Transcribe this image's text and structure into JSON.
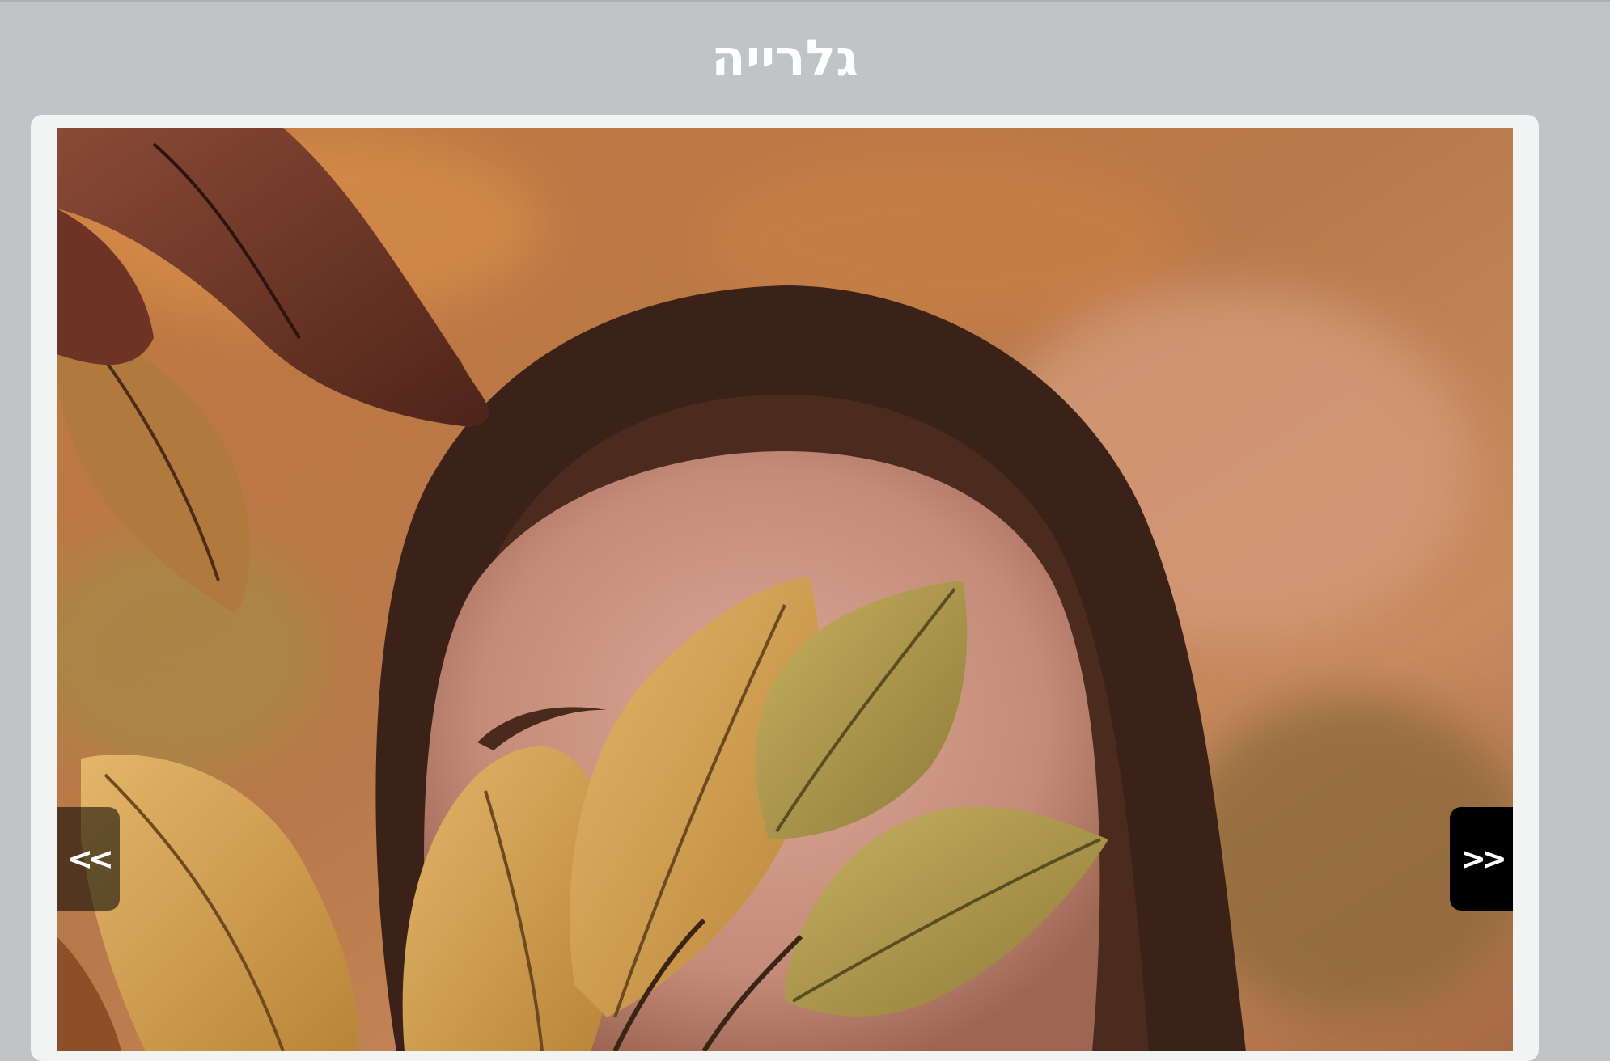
{
  "header": {
    "title": "גלרייה"
  },
  "gallery": {
    "prev_label": "<<",
    "next_label": ">>",
    "image_subject": "woman-holding-autumn-leaves-photo"
  },
  "colors": {
    "page_background": "#c0c4c7",
    "card_background": "#f2f3f3",
    "title_text": "#ffffff",
    "nav_next_background": "#000000"
  }
}
